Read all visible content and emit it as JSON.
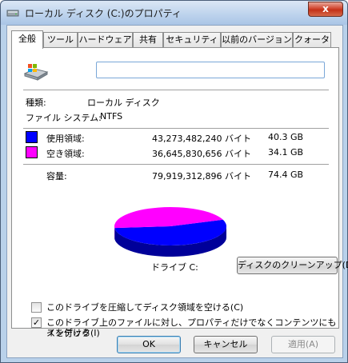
{
  "window": {
    "title": "ローカル ディスク (C:)のプロパティ",
    "close_label": "x"
  },
  "tabs": [
    {
      "label": "全般"
    },
    {
      "label": "ツール"
    },
    {
      "label": "ハードウェア"
    },
    {
      "label": "共有"
    },
    {
      "label": "セキュリティ"
    },
    {
      "label": "以前のバージョン"
    },
    {
      "label": "クォータ"
    }
  ],
  "general": {
    "name_value": "",
    "type_label": "種類:",
    "type_value": "ローカル ディスク",
    "fs_label": "ファイル システム:",
    "fs_value": "NTFS",
    "used": {
      "label": "使用領域:",
      "bytes": "43,273,482,240 バイト",
      "gb": "40.3 GB",
      "color": "#0000ff"
    },
    "free": {
      "label": "空き領域:",
      "bytes": "36,645,830,656 バイト",
      "gb": "34.1 GB",
      "color": "#ff00ff"
    },
    "capacity": {
      "label": "容量:",
      "bytes": "79,919,312,896 バイト",
      "gb": "74.4 GB"
    },
    "drive_label": "ドライブ C:",
    "cleanup_button": "ディスクのクリーンアップ(D)",
    "compress": {
      "label": "このドライブを圧縮してディスク領域を空ける(C)",
      "checked": false
    },
    "index": {
      "label_line1": "このドライブ上のファイルに対し、プロパティだけでなくコンテンツにもインデック",
      "label_line2": "スを付ける(I)",
      "checked": true,
      "mark": "✓"
    }
  },
  "chart_data": {
    "type": "pie",
    "categories": [
      "使用領域",
      "空き領域"
    ],
    "values": [
      43273482240,
      36645830656
    ],
    "colors": [
      "#0000ff",
      "#ff00ff"
    ]
  },
  "buttons": {
    "ok": "OK",
    "cancel": "キャンセル",
    "apply": "適用(A)"
  }
}
